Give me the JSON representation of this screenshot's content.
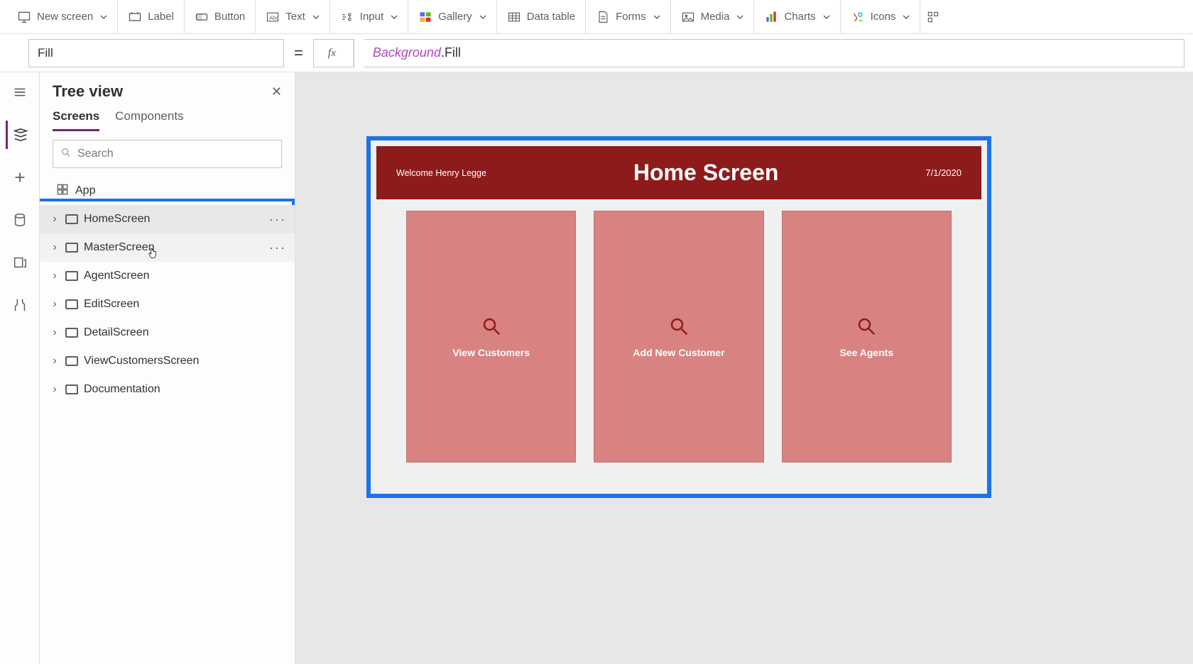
{
  "ribbon": {
    "new_screen": "New screen",
    "label": "Label",
    "button": "Button",
    "text": "Text",
    "input": "Input",
    "gallery": "Gallery",
    "data_table": "Data table",
    "forms": "Forms",
    "media": "Media",
    "charts": "Charts",
    "icons": "Icons"
  },
  "formula": {
    "property": "Fill",
    "token_prop": "Background",
    "token_rest": ".Fill"
  },
  "tree": {
    "title": "Tree view",
    "tab_screens": "Screens",
    "tab_components": "Components",
    "search_placeholder": "Search",
    "app": "App",
    "items": [
      {
        "label": "HomeScreen"
      },
      {
        "label": "MasterScreen"
      },
      {
        "label": "AgentScreen"
      },
      {
        "label": "EditScreen"
      },
      {
        "label": "DetailScreen"
      },
      {
        "label": "ViewCustomersScreen"
      },
      {
        "label": "Documentation"
      }
    ]
  },
  "home": {
    "welcome": "Welcome Henry Legge",
    "title": "Home Screen",
    "date": "7/1/2020",
    "cards": [
      {
        "label": "View Customers"
      },
      {
        "label": "Add New Customer"
      },
      {
        "label": "See Agents"
      }
    ]
  }
}
